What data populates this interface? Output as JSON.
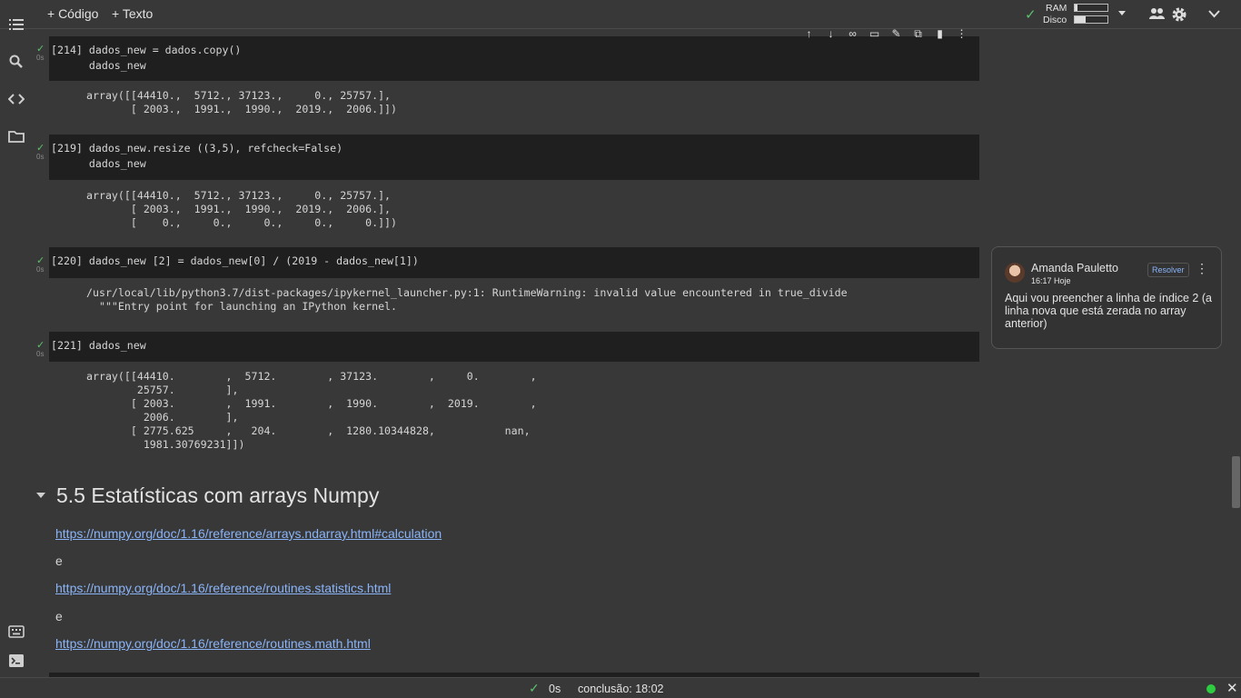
{
  "toolbar": {
    "add_code": "+ Código",
    "add_text": "+ Texto",
    "ram_label": "RAM",
    "disk_label": "Disco",
    "ram_fill": 0.08,
    "disk_fill": 0.33
  },
  "cells": [
    {
      "exec": "[214]",
      "time": "0s",
      "code": [
        "dados_new = dados.copy()",
        "dados_new"
      ],
      "output": [
        "array([[44410.,  5712., 37123.,     0., 25757.],",
        "       [ 2003.,  1991.,  1990.,  2019.,  2006.]])"
      ]
    },
    {
      "exec": "[219]",
      "time": "0s",
      "code": [
        "dados_new.resize ((3,5), refcheck=False)",
        "dados_new"
      ],
      "output": [
        "array([[44410.,  5712., 37123.,     0., 25757.],",
        "       [ 2003.,  1991.,  1990.,  2019.,  2006.],",
        "       [    0.,     0.,     0.,     0.,     0.]])"
      ]
    },
    {
      "exec": "[220]",
      "time": "0s",
      "code": [
        "dados_new [2] = dados_new[0] / (2019 - dados_new[1])"
      ],
      "output": [
        "/usr/local/lib/python3.7/dist-packages/ipykernel_launcher.py:1: RuntimeWarning: invalid value encountered in true_divide",
        "  \"\"\"Entry point for launching an IPython kernel."
      ]
    },
    {
      "exec": "[221]",
      "time": "0s",
      "code": [
        "dados_new"
      ],
      "output": [
        "array([[44410.        ,  5712.        , 37123.        ,     0.        ,",
        "        25757.        ],",
        "       [ 2003.        ,  1991.        ,  1990.        ,  2019.        ,",
        "         2006.        ],",
        "       [ 2775.625     ,   204.        ,  1280.10344828,           nan,",
        "         1981.30769231]])"
      ]
    }
  ],
  "section": {
    "title": "5.5 Estatísticas com arrays Numpy",
    "link1": "https://numpy.org/doc/1.16/reference/arrays.ndarray.html#calculation",
    "sep1": "e",
    "link2": "https://numpy.org/doc/1.16/reference/routines.statistics.html",
    "sep2": "e",
    "link3": "https://numpy.org/doc/1.16/reference/routines.math.html"
  },
  "comment": {
    "author": "Amanda Pauletto",
    "time": "16:17 Hoje",
    "resolve_label": "Resolver",
    "text": "Aqui vou preencher a linha de índice 2 (a linha nova que está zerada no array anterior)"
  },
  "status": {
    "duration": "0s",
    "completion": "conclusão: 18:02"
  },
  "icons": [
    "toc-icon",
    "search-icon",
    "code-snippets-icon",
    "folder-icon",
    "command-palette-icon",
    "terminal-icon",
    "share-icon",
    "settings-icon",
    "expand-icon"
  ],
  "colors": {
    "accent_link": "#8ab4f8",
    "check_green": "#5cc06d",
    "status_dot": "#2ecc40"
  }
}
